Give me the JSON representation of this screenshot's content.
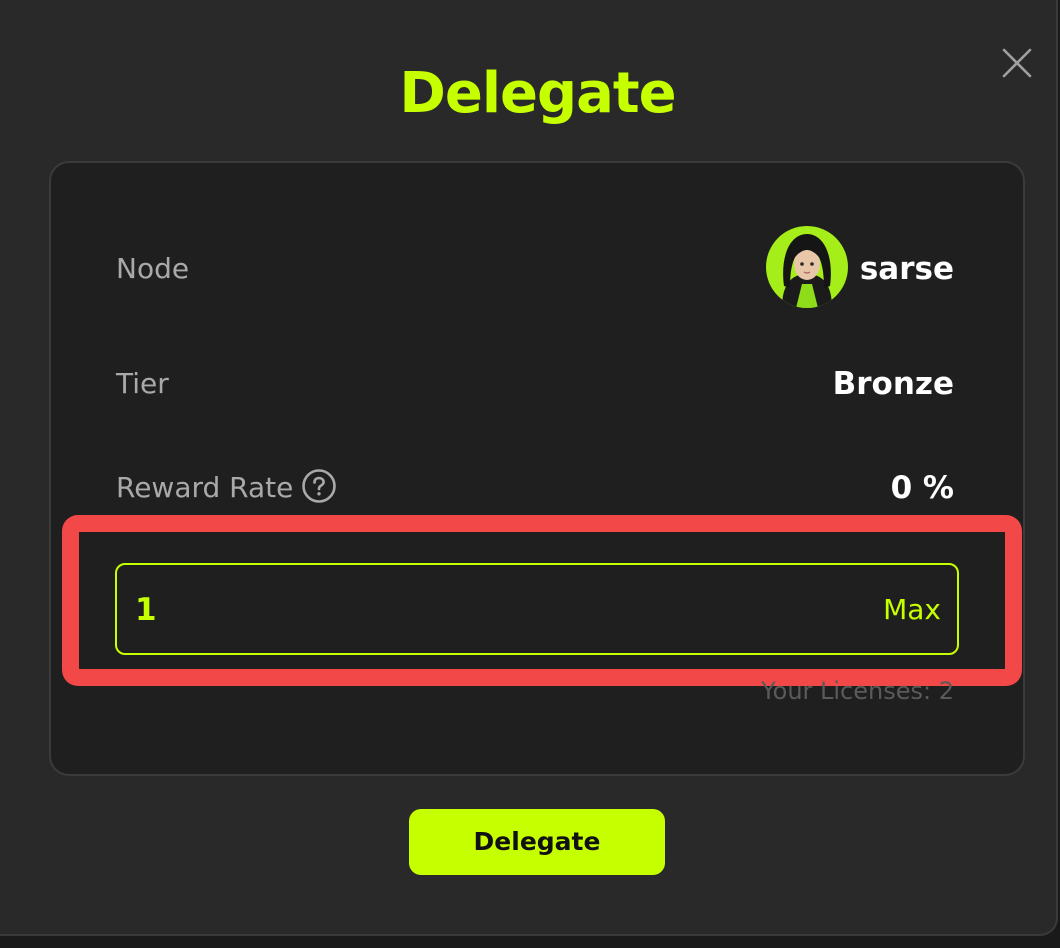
{
  "modal": {
    "title": "Delegate",
    "close_icon": "close-icon"
  },
  "details": {
    "node_label": "Node",
    "node_value": "sarse",
    "avatar_icon": "user-avatar",
    "tier_label": "Tier",
    "tier_value": "Bronze",
    "reward_label": "Reward Rate",
    "reward_help_icon": "question-circle-icon",
    "reward_value": "0 %"
  },
  "amount_input": {
    "value": "1",
    "max_label": "Max",
    "licenses_text": "Your Licenses: 2"
  },
  "actions": {
    "delegate_label": "Delegate"
  },
  "colors": {
    "accent": "#c6ff00",
    "highlight": "#f24848",
    "background": "#292929",
    "card": "#1f1f1f"
  }
}
